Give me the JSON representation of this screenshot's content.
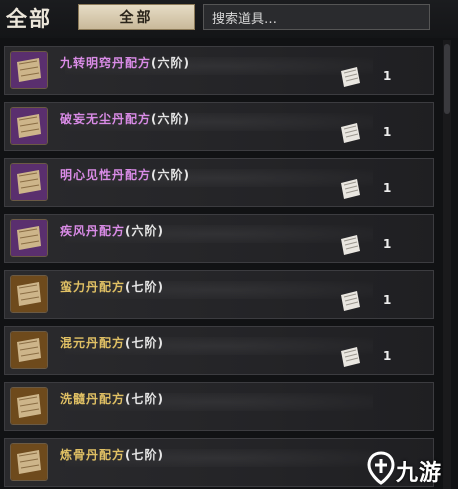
{
  "header": {
    "category_title": "全部",
    "category_tab": "全部",
    "search_placeholder": "搜索道具…"
  },
  "colors": {
    "purple_name": "#d98be6",
    "gold_name": "#e0c064"
  },
  "items": [
    {
      "name": "九转明窍丹配方",
      "grade": "(六阶)",
      "count": "1",
      "rarity": "purple"
    },
    {
      "name": "破妄无尘丹配方",
      "grade": "(六阶)",
      "count": "1",
      "rarity": "purple"
    },
    {
      "name": "明心见性丹配方",
      "grade": "(六阶)",
      "count": "1",
      "rarity": "purple"
    },
    {
      "name": "疾风丹配方",
      "grade": "(六阶)",
      "count": "1",
      "rarity": "purple"
    },
    {
      "name": "蛮力丹配方",
      "grade": "(七阶)",
      "count": "1",
      "rarity": "gold"
    },
    {
      "name": "混元丹配方",
      "grade": "(七阶)",
      "count": "1",
      "rarity": "gold"
    },
    {
      "name": "洗髓丹配方",
      "grade": "(七阶)",
      "count": "",
      "rarity": "gold"
    },
    {
      "name": "炼骨丹配方",
      "grade": "(七阶)",
      "count": "",
      "rarity": "gold"
    }
  ],
  "watermark": {
    "text": "九游",
    "icon": "jiuyou-logo-icon"
  }
}
